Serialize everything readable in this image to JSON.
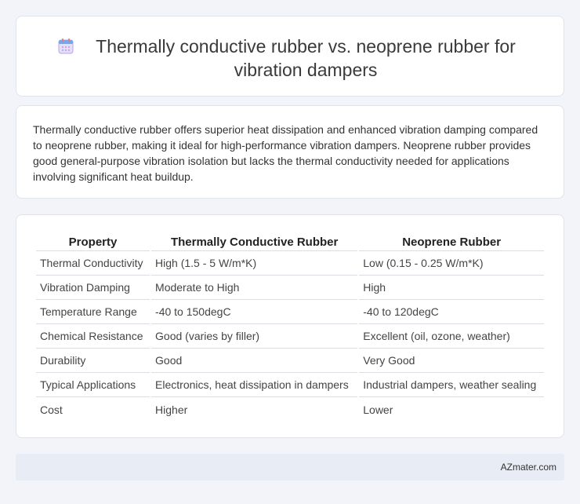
{
  "header": {
    "title": "Thermally conductive rubber vs. neoprene rubber for vibration dampers",
    "icon": "calendar-icon"
  },
  "summary": {
    "text": "Thermally conductive rubber offers superior heat dissipation and enhanced vibration damping compared to neoprene rubber, making it ideal for high-performance vibration dampers. Neoprene rubber provides good general-purpose vibration isolation but lacks the thermal conductivity needed for applications involving significant heat buildup."
  },
  "table": {
    "headers": [
      "Property",
      "Thermally Conductive Rubber",
      "Neoprene Rubber"
    ],
    "rows": [
      [
        "Thermal Conductivity",
        "High (1.5 - 5 W/m*K)",
        "Low (0.15 - 0.25 W/m*K)"
      ],
      [
        "Vibration Damping",
        "Moderate to High",
        "High"
      ],
      [
        "Temperature Range",
        "-40 to 150degC",
        "-40 to 120degC"
      ],
      [
        "Chemical Resistance",
        "Good (varies by filler)",
        "Excellent (oil, ozone, weather)"
      ],
      [
        "Durability",
        "Good",
        "Very Good"
      ],
      [
        "Typical Applications",
        "Electronics, heat dissipation in dampers",
        "Industrial dampers, weather sealing"
      ],
      [
        "Cost",
        "Higher",
        "Lower"
      ]
    ]
  },
  "footer": {
    "brand": "AZmater.com"
  }
}
